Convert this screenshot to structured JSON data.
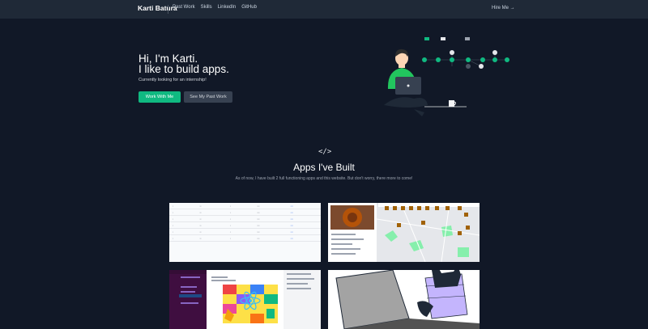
{
  "nav": {
    "brand": "Karti Batura",
    "links": [
      "Past Work",
      "Skills",
      "LinkedIn",
      "GitHub"
    ],
    "hire": "Hire Me →"
  },
  "hero": {
    "line1": "Hi, I'm Karti.",
    "line2": "I like to build apps.",
    "subtitle": "Currently looking for an internship!",
    "primary_button": "Work With Me",
    "secondary_button": "See My Past Work"
  },
  "apps": {
    "icon": "</>",
    "title": "Apps I've Built",
    "subtitle": "As of now, I have built 2 full functioning apps and this website. But don't worry, there more to come!"
  },
  "colors": {
    "background": "#111827",
    "nav": "#1f2937",
    "accent": "#10b981"
  }
}
